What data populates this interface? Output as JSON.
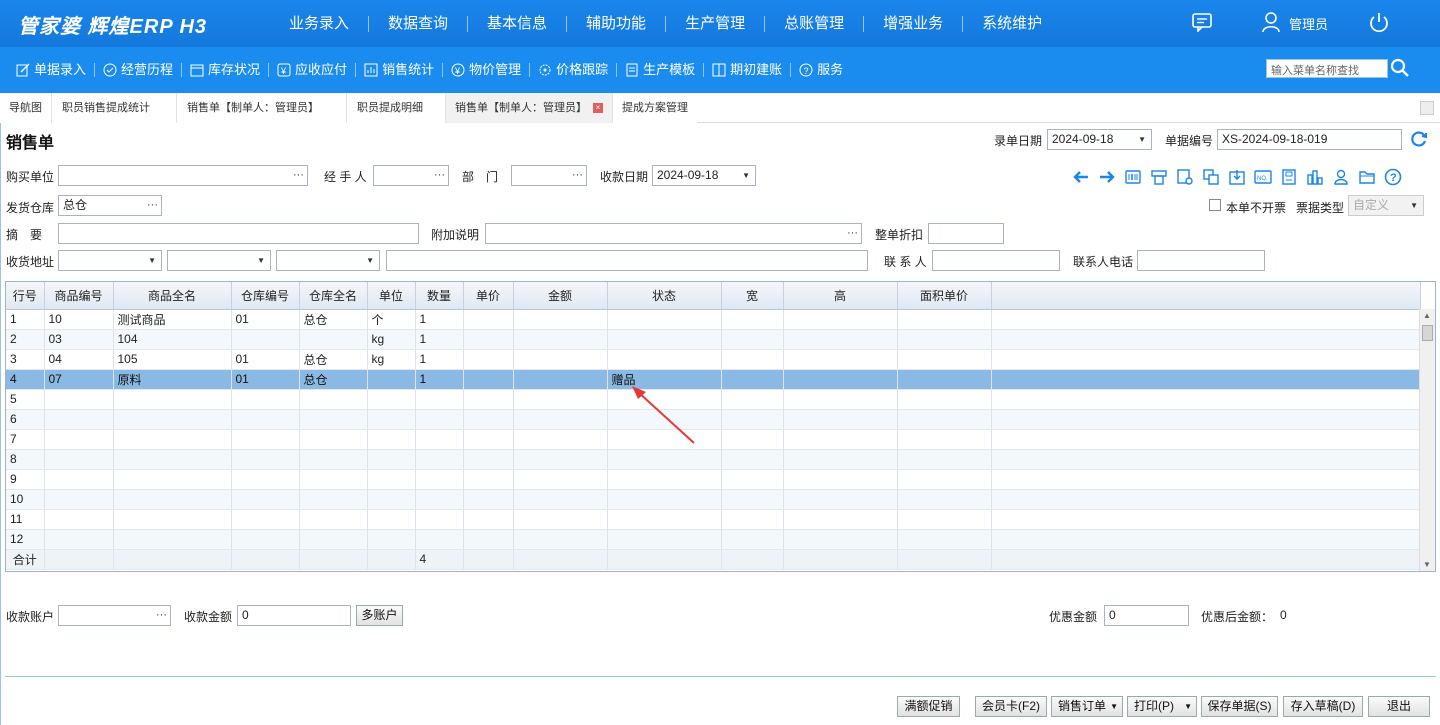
{
  "app": {
    "logo_text": "管家婆 辉煌ERP H3",
    "user": "管理员"
  },
  "main_menu": [
    "业务录入",
    "数据查询",
    "基本信息",
    "辅助功能",
    "生产管理",
    "总账管理",
    "增强业务",
    "系统维护"
  ],
  "quick_menu": [
    "单据录入",
    "经营历程",
    "库存状况",
    "应收应付",
    "销售统计",
    "物价管理",
    "价格跟踪",
    "生产模板",
    "期初建账",
    "服务"
  ],
  "menu_search_placeholder": "输入菜单名称查找",
  "tabs": [
    "导航图",
    "职员销售提成统计",
    "销售单【制单人：管理员】",
    "职员提成明细",
    "销售单【制单人：管理员】",
    "提成方案管理"
  ],
  "form": {
    "title": "销售单",
    "entry_date_label": "录单日期",
    "entry_date": "2024-09-18",
    "doc_no_label": "单据编号",
    "doc_no": "XS-2024-09-18-019",
    "buyer_label": "购买单位",
    "handler_label": "经 手 人",
    "dept_label": "部　门",
    "receipt_date_label": "收款日期",
    "receipt_date": "2024-09-18",
    "warehouse_label": "发货仓库",
    "warehouse": "总仓",
    "no_invoice_label": "本单不开票",
    "bill_type_label": "票据类型",
    "bill_type": "自定义",
    "summary_label": "摘　要",
    "extra_label": "附加说明",
    "discount_label": "整单折扣",
    "address_label": "收货地址",
    "contact_label": "联 系 人",
    "contact_phone_label": "联系人电话"
  },
  "grid": {
    "columns": [
      "行号",
      "商品编号",
      "商品全名",
      "仓库编号",
      "仓库全名",
      "单位",
      "数量",
      "单价",
      "金额",
      "状态",
      "宽",
      "高",
      "面积单价",
      ""
    ],
    "rows": [
      [
        "1",
        "10",
        "测试商品",
        "01",
        "总仓",
        "个",
        "1",
        "",
        "",
        "",
        "",
        "",
        "",
        ""
      ],
      [
        "2",
        "03",
        "104",
        "",
        "",
        "kg",
        "1",
        "",
        "",
        "",
        "",
        "",
        "",
        ""
      ],
      [
        "3",
        "04",
        "105",
        "01",
        "总仓",
        "kg",
        "1",
        "",
        "",
        "",
        "",
        "",
        "",
        ""
      ],
      [
        "4",
        "07",
        "原料",
        "01",
        "总仓",
        "",
        "1",
        "",
        "",
        "赠品",
        "",
        "",
        "",
        ""
      ],
      [
        "5",
        "",
        "",
        "",
        "",
        "",
        "",
        "",
        "",
        "",
        "",
        "",
        "",
        ""
      ],
      [
        "6",
        "",
        "",
        "",
        "",
        "",
        "",
        "",
        "",
        "",
        "",
        "",
        "",
        ""
      ],
      [
        "7",
        "",
        "",
        "",
        "",
        "",
        "",
        "",
        "",
        "",
        "",
        "",
        "",
        ""
      ],
      [
        "8",
        "",
        "",
        "",
        "",
        "",
        "",
        "",
        "",
        "",
        "",
        "",
        "",
        ""
      ],
      [
        "9",
        "",
        "",
        "",
        "",
        "",
        "",
        "",
        "",
        "",
        "",
        "",
        "",
        ""
      ],
      [
        "10",
        "",
        "",
        "",
        "",
        "",
        "",
        "",
        "",
        "",
        "",
        "",
        "",
        ""
      ],
      [
        "11",
        "",
        "",
        "",
        "",
        "",
        "",
        "",
        "",
        "",
        "",
        "",
        "",
        ""
      ],
      [
        "12",
        "",
        "",
        "",
        "",
        "",
        "",
        "",
        "",
        "",
        "",
        "",
        "",
        ""
      ]
    ],
    "total_label": "合计",
    "total_qty": "4",
    "selected_row": 4
  },
  "footer": {
    "account_label": "收款账户",
    "amount_label": "收款金额",
    "amount": "0",
    "multi_account": "多账户",
    "discount_label": "优惠金额",
    "discount": "0",
    "after_discount_label": "优惠后金额：",
    "after_discount": "0"
  },
  "buttons": [
    "满额促销",
    "会员卡(F2)",
    "销售订单",
    "打印(P)",
    "保存单据(S)",
    "存入草稿(D)",
    "退出"
  ],
  "colors": {
    "topbar": "#1478dc",
    "quickbar": "#1a8cf0",
    "selected_row": "#8ab9e3",
    "annotation_arrow": "#e53935"
  }
}
